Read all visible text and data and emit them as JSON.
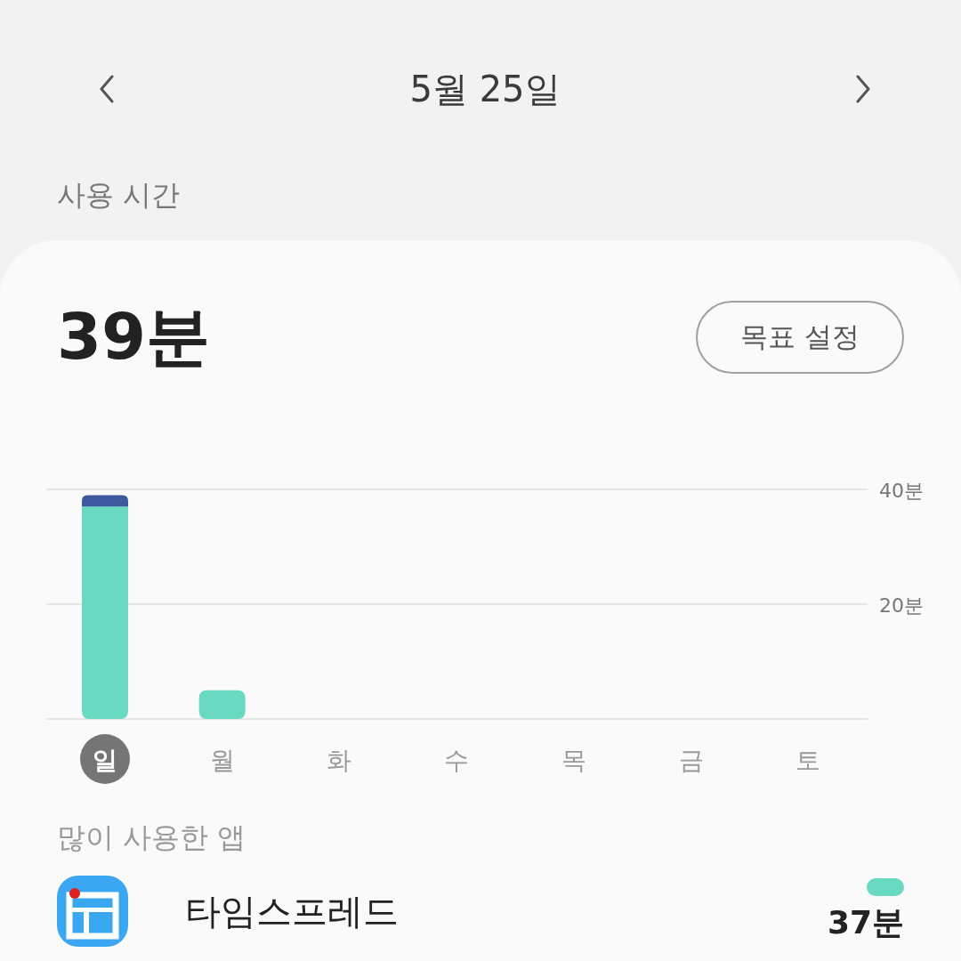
{
  "header": {
    "date": "5월 25일"
  },
  "section_label": "사용 시간",
  "total": "39분",
  "goal_button": "목표 설정",
  "chart": {
    "chart_data": {
      "type": "bar",
      "stacked": true,
      "categories": [
        "일",
        "월",
        "화",
        "수",
        "목",
        "금",
        "토"
      ],
      "series": [
        {
          "color": "#6ad9c1",
          "values": [
            37,
            5,
            null,
            null,
            null,
            null,
            null
          ]
        },
        {
          "color": "#3d5a9e",
          "values": [
            2,
            null,
            null,
            null,
            null,
            null,
            null
          ]
        }
      ],
      "ylim": [
        0,
        40
      ],
      "yticks": [
        {
          "value": 20,
          "label": "20분"
        },
        {
          "value": 40,
          "label": "40분"
        }
      ]
    },
    "day_states": [
      {
        "selected": true
      },
      {
        "selected": false
      },
      {
        "selected": false
      },
      {
        "selected": false
      },
      {
        "selected": false
      },
      {
        "selected": false
      },
      {
        "selected": false
      }
    ]
  },
  "top_apps": {
    "title": "많이 사용한 앱",
    "apps": [
      {
        "name": "타임스프레드",
        "time": "37분"
      }
    ]
  }
}
